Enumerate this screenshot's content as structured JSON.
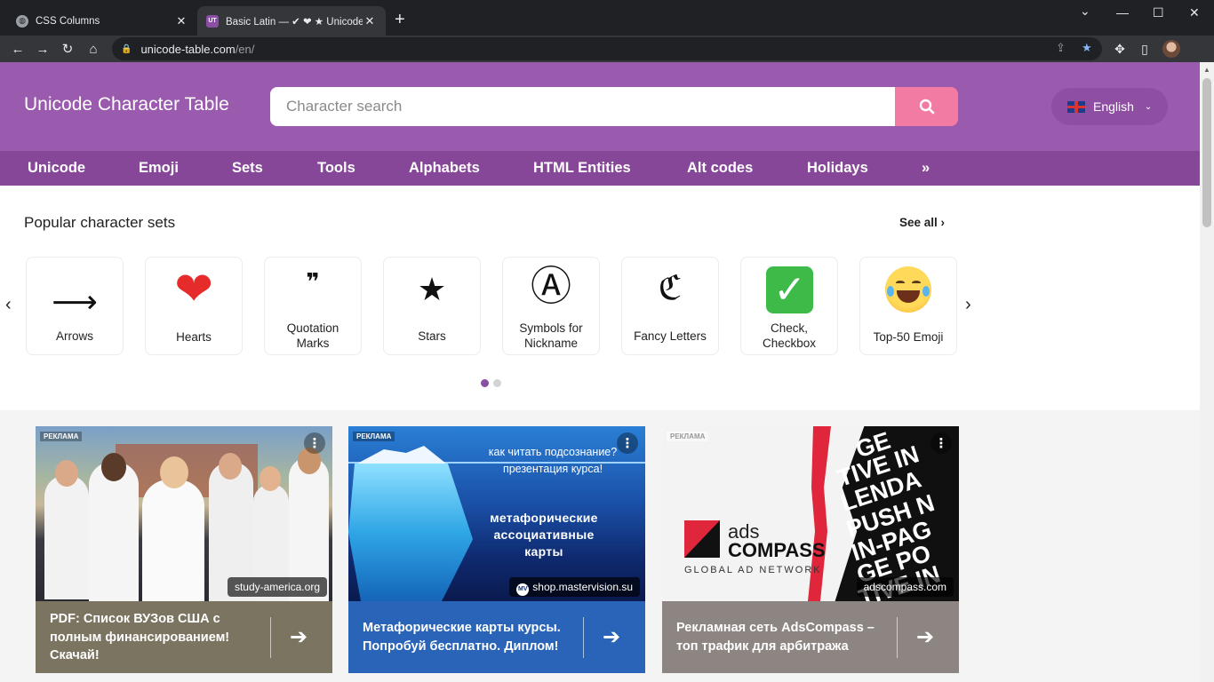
{
  "browser": {
    "tabs": [
      {
        "title": "CSS Columns",
        "close": "✕"
      },
      {
        "title": "Basic Latin — ✔ ❤ ★ Unicode",
        "close": "✕"
      }
    ],
    "new_tab": "+",
    "window_controls": {
      "minimize": "—",
      "maximize": "☐",
      "close": "✕",
      "dropdown": "⌄"
    },
    "url": {
      "domain": "unicode-table.com",
      "path": "/en/"
    },
    "icons": [
      "back-icon",
      "forward-icon",
      "reload-icon",
      "home-icon",
      "lock-icon",
      "share-icon",
      "star-icon",
      "puzzle-icon",
      "side-panel-icon",
      "profile-avatar"
    ],
    "colors": {
      "tab_strip": "#202124",
      "toolbar": "#35363a"
    }
  },
  "site": {
    "logo": "Unicode Character Table",
    "search": {
      "placeholder": "Character search"
    },
    "language": {
      "label": "English"
    },
    "colors": {
      "header": "#9a5aae",
      "nav": "#874799",
      "search_button": "#f27ba3"
    },
    "nav": [
      "Unicode",
      "Emoji",
      "Sets",
      "Tools",
      "Alphabets",
      "HTML Entities",
      "Alt codes",
      "Holidays",
      "»"
    ]
  },
  "popular": {
    "title": "Popular character sets",
    "see_all": "See all",
    "sets": [
      {
        "glyph": "⟶",
        "label": "Arrows"
      },
      {
        "glyph": "❤",
        "label": "Hearts"
      },
      {
        "glyph": "❞",
        "label": "Quotation Marks"
      },
      {
        "glyph": "★",
        "label": "Stars"
      },
      {
        "glyph": "Ⓐ",
        "label": "Symbols for Nickname"
      },
      {
        "glyph": "ℭ",
        "label": "Fancy Letters"
      },
      {
        "glyph": "✓",
        "label": "Check, Checkbox"
      },
      {
        "glyph": "😂",
        "label": "Top-50 Emoji"
      }
    ],
    "pager": {
      "pages": 2,
      "current": 1
    }
  },
  "ads": [
    {
      "tag": "РЕКЛАМА",
      "domain": "study-america.org",
      "text": "PDF: Список ВУЗов США с полным финансированием! Скачай!"
    },
    {
      "tag": "РЕКЛАМА",
      "domain": "shop.mastervision.su",
      "image_text_top": "как читать подсознание? презентация курса!",
      "image_text_mid": "метафорические ассоциативные карты",
      "text": "Метафорические карты курсы. Попробуй бесплатно. Диплом!"
    },
    {
      "tag": "РЕКЛАМА",
      "domain": "adscompass.com",
      "logo_word1": "ads",
      "logo_word2": "COMPASS",
      "logo_sub": "GLOBAL AD NETWORK",
      "image_words": [
        "GE",
        "TIVE IN",
        "LENDA",
        "PUSH N",
        "IN-PAG",
        "GE PO",
        "TIVE IN"
      ],
      "text": "Рекламная сеть AdsCompass – топ трафик для арбитража"
    }
  ]
}
